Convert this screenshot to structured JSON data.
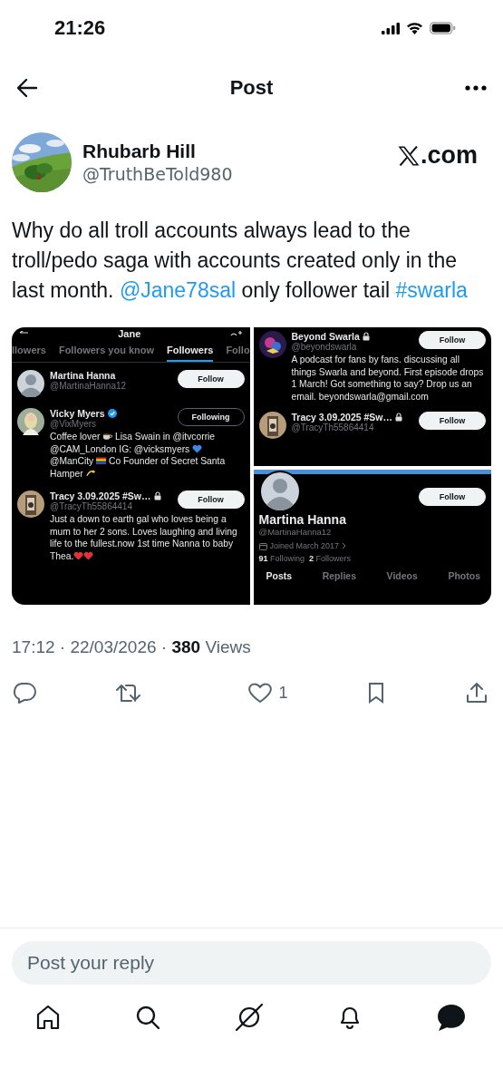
{
  "status_bar": {
    "time": "21:26"
  },
  "header": {
    "title": "Post"
  },
  "author": {
    "name": "Rhubarb Hill",
    "handle": "@TruthBeTold980",
    "source_suffix": ".com"
  },
  "post": {
    "segments": [
      {
        "kind": "text",
        "text": "Why do all troll accounts always lead to the troll/pedo saga with accounts created only in the last month. "
      },
      {
        "kind": "mention",
        "text": "@Jane78sal"
      },
      {
        "kind": "text",
        "text": " only follower tail "
      },
      {
        "kind": "hashtag",
        "text": "#swarla"
      }
    ]
  },
  "media": {
    "followers_list": {
      "title": "Jane",
      "tabs": [
        {
          "label": "llowers",
          "selected": false
        },
        {
          "label": "Followers you know",
          "selected": false
        },
        {
          "label": "Followers",
          "selected": true
        },
        {
          "label": "Follo",
          "selected": false
        }
      ],
      "users": [
        {
          "name": "Martina Hanna",
          "handle": "@MartinaHanna12",
          "avatar": {
            "kind": "placeholder"
          },
          "button": "Follow",
          "following": false
        },
        {
          "name": "Vicky Myers",
          "handle": "@VixMyers",
          "verified": true,
          "avatar": {
            "kind": "person"
          },
          "button": "Following",
          "following": true,
          "bio": [
            {
              "kind": "text",
              "text": "Coffee lover "
            },
            {
              "kind": "coffee"
            },
            {
              "kind": "text",
              "text": " Lisa Swain in @itvcorrie @CAM_London IG: @vicksmyers "
            },
            {
              "kind": "blue-heart"
            },
            {
              "kind": "text",
              "text": " @ManCity "
            },
            {
              "kind": "rainbow-flag"
            },
            {
              "kind": "text",
              "text": " Co Founder of Secret Santa Hamper "
            },
            {
              "kind": "dizzy"
            }
          ]
        },
        {
          "name": "Tracy 3.09.2025 #Sw…",
          "handle": "@TracyTh55864414",
          "locked": true,
          "avatar": {
            "kind": "picture"
          },
          "button": "Follow",
          "following": false,
          "bio": [
            {
              "kind": "text",
              "text": "Just a down to earth gal who loves being a mum to her 2 sons. Loves laughing and living life to the fullest.now 1st time Nanna to baby Thea."
            },
            {
              "kind": "red-heart"
            },
            {
              "kind": "red-heart"
            }
          ]
        }
      ]
    },
    "bios_list": {
      "users": [
        {
          "name": "Beyond Swarla",
          "handle": "@beyondswarla",
          "locked": true,
          "avatar": {
            "kind": "logo"
          },
          "button": "Follow",
          "following": false,
          "bio": [
            {
              "kind": "text",
              "text": "A podcast for fans by fans. discussing all things Swarla and beyond. First episode drops 1 March! Got something to say? Drop us an email. beyondswarla@gmail.com"
            }
          ]
        },
        {
          "name": "Tracy 3.09.2025 #Sw…",
          "handle": "@TracyTh55864414",
          "locked": true,
          "avatar": {
            "kind": "picture"
          },
          "button": "Follow",
          "following": false
        }
      ]
    },
    "profile": {
      "name": "Martina Hanna",
      "handle": "@MartinaHanna12",
      "button": "Follow",
      "joined": "Joined March 2017",
      "stats": [
        "**91** Following",
        "**2** Followers"
      ],
      "tabs": [
        {
          "label": "Posts",
          "selected": true
        },
        {
          "label": "Replies",
          "selected": false
        },
        {
          "label": "Videos",
          "selected": false
        },
        {
          "label": "Photos",
          "selected": false
        }
      ]
    }
  },
  "meta": {
    "text": "17:12 · 22/03/2026 · **380** Views"
  },
  "actions": [
    {
      "kind": "reply"
    },
    {
      "kind": "repost"
    },
    {
      "kind": "like",
      "count": "1"
    },
    {
      "kind": "bookmark"
    },
    {
      "kind": "share"
    }
  ],
  "reply_field": {
    "placeholder": "Post your reply"
  },
  "nav": [
    {
      "kind": "home",
      "selected": false
    },
    {
      "kind": "search",
      "selected": false
    },
    {
      "kind": "grok",
      "selected": false
    },
    {
      "kind": "notifications",
      "selected": false
    },
    {
      "kind": "messages",
      "selected": true
    }
  ]
}
